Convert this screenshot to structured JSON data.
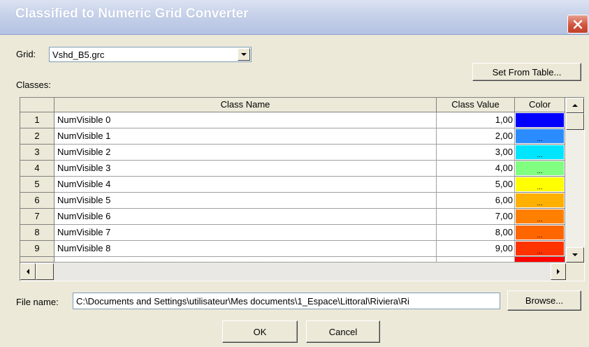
{
  "window": {
    "title": "Classified to Numeric Grid Converter"
  },
  "grid_field": {
    "label": "Grid:",
    "value": "Vshd_B5.grc"
  },
  "classes_label": "Classes:",
  "set_from_table_label": "Set From Table...",
  "table": {
    "headers": {
      "class_name": "Class Name",
      "class_value": "Class Value",
      "color": "Color"
    },
    "rows": [
      {
        "num": "1",
        "name": "NumVisible 0",
        "value": "1,00",
        "color": "#0000ff"
      },
      {
        "num": "2",
        "name": "NumVisible 1",
        "value": "2,00",
        "color": "#2b8cff"
      },
      {
        "num": "3",
        "name": "NumVisible 2",
        "value": "3,00",
        "color": "#00e5ff"
      },
      {
        "num": "4",
        "name": "NumVisible 3",
        "value": "4,00",
        "color": "#80ff80"
      },
      {
        "num": "5",
        "name": "NumVisible 4",
        "value": "5,00",
        "color": "#ffff00"
      },
      {
        "num": "6",
        "name": "NumVisible 5",
        "value": "6,00",
        "color": "#ffb000"
      },
      {
        "num": "7",
        "name": "NumVisible 6",
        "value": "7,00",
        "color": "#ff8000"
      },
      {
        "num": "8",
        "name": "NumVisible 7",
        "value": "8,00",
        "color": "#ff6600"
      },
      {
        "num": "9",
        "name": "NumVisible 8",
        "value": "9,00",
        "color": "#ff3300"
      }
    ],
    "color_button_text": "..."
  },
  "file_name": {
    "label": "File name:",
    "value": "C:\\Documents and Settings\\utilisateur\\Mes documents\\1_Espace\\Littoral\\Riviera\\Ri"
  },
  "browse_label": "Browse...",
  "ok_label": "OK",
  "cancel_label": "Cancel"
}
